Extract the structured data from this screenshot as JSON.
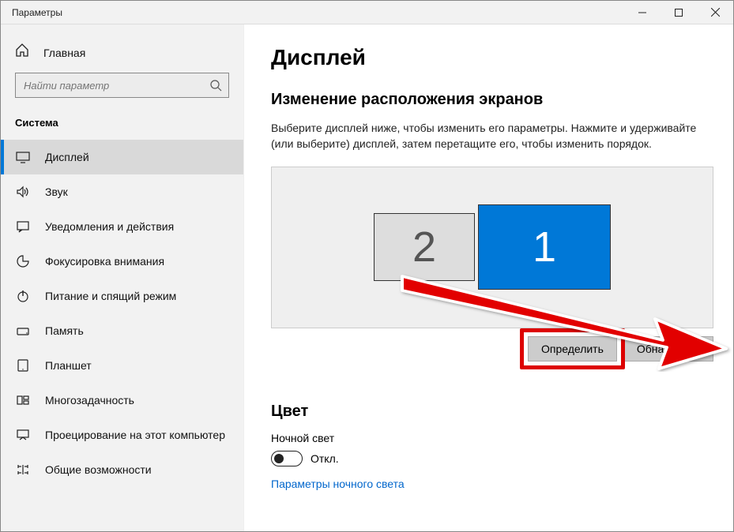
{
  "window": {
    "title": "Параметры"
  },
  "sidebar": {
    "home": "Главная",
    "search_placeholder": "Найти параметр",
    "section": "Система",
    "items": [
      {
        "label": "Дисплей"
      },
      {
        "label": "Звук"
      },
      {
        "label": "Уведомления и действия"
      },
      {
        "label": "Фокусировка внимания"
      },
      {
        "label": "Питание и спящий режим"
      },
      {
        "label": "Память"
      },
      {
        "label": "Планшет"
      },
      {
        "label": "Многозадачность"
      },
      {
        "label": "Проецирование на этот компьютер"
      },
      {
        "label": "Общие возможности"
      }
    ]
  },
  "main": {
    "title": "Дисплей",
    "section_title": "Изменение расположения экранов",
    "description": "Выберите дисплей ниже, чтобы изменить его параметры. Нажмите и удерживайте (или выберите) дисплей, затем перетащите его, чтобы изменить порядок.",
    "monitors": {
      "primary": "1",
      "secondary": "2"
    },
    "identify_button": "Определить",
    "detect_button": "Обнаружить",
    "color_title": "Цвет",
    "night_light_label": "Ночной свет",
    "toggle_state": "Откл.",
    "night_light_link": "Параметры ночного света"
  }
}
